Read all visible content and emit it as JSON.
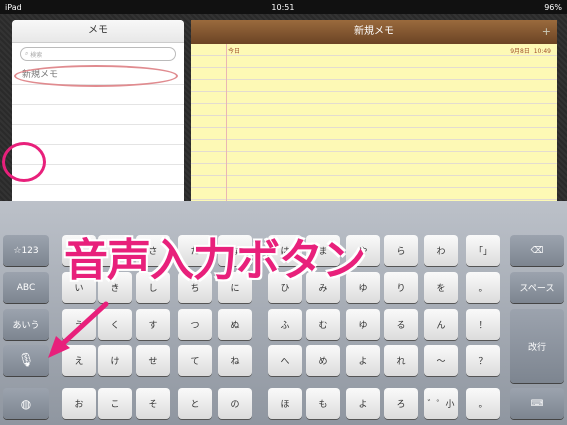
{
  "status": {
    "left": "iPad",
    "time": "10:51",
    "battery": "96%"
  },
  "notes_list": {
    "title": "メモ",
    "search_placeholder": "検索",
    "first_item": "新規メモ"
  },
  "note": {
    "title": "新規メモ",
    "today": "今日",
    "date": "9月8日",
    "time": "10:49"
  },
  "keyboard": {
    "left": [
      "☆123",
      "ABC",
      "あいう",
      "",
      ""
    ],
    "col1": [
      "",
      "",
      "",
      "え",
      "お"
    ],
    "rows": [
      [
        "あ",
        "か",
        "さ",
        "た",
        "な",
        "は",
        "ま",
        "や",
        "ら",
        "わ",
        "「」"
      ],
      [
        "い",
        "き",
        "し",
        "ち",
        "に",
        "ひ",
        "み",
        "ゆ",
        "り",
        "を",
        "。"
      ],
      [
        "う",
        "く",
        "す",
        "つ",
        "ぬ",
        "ふ",
        "む",
        "ゆ",
        "る",
        "ん",
        "！"
      ],
      [
        "え",
        "け",
        "せ",
        "て",
        "ね",
        "へ",
        "め",
        "よ",
        "れ",
        "〜",
        "？"
      ],
      [
        "お",
        "こ",
        "そ",
        "と",
        "の",
        "ほ",
        "も",
        "よ",
        "ろ",
        "゛゜小",
        "。"
      ]
    ],
    "right": [
      "⌫",
      "スペース",
      "改行",
      ""
    ],
    "overlay": "音声入力ボタン"
  },
  "colors": {
    "accent": "#e8207b",
    "note_paper": "#fdf9b5"
  }
}
